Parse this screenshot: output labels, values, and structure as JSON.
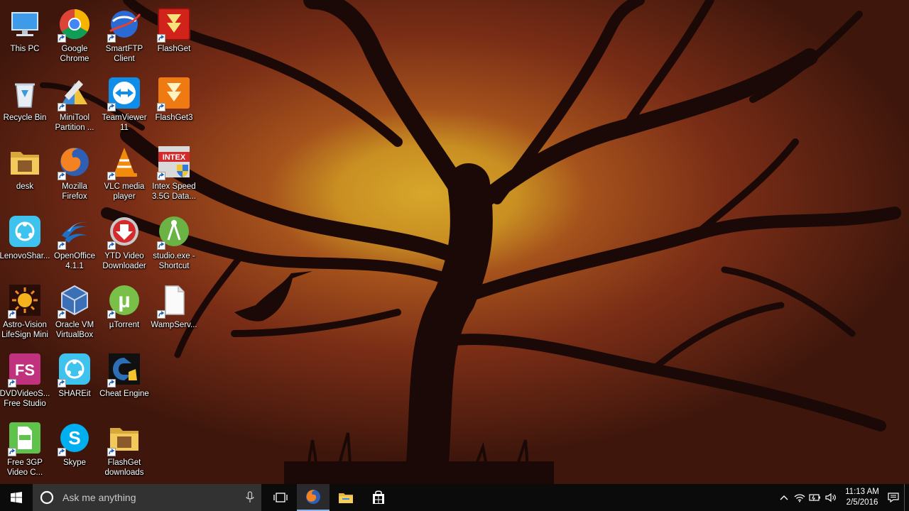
{
  "desktop": {
    "icons": [
      {
        "label": "This PC",
        "icon": "this-pc-icon",
        "shortcut": false
      },
      {
        "label": "Recycle Bin",
        "icon": "recycle-bin-icon",
        "shortcut": false
      },
      {
        "label": "desk",
        "icon": "folder-icon",
        "shortcut": false
      },
      {
        "label": "LenovoShar...",
        "icon": "lenovo-shareit-icon",
        "shortcut": false
      },
      {
        "label": "Astro-Vision LifeSign Mini",
        "icon": "astro-vision-icon",
        "shortcut": true
      },
      {
        "label": "DVDVideoS... Free Studio",
        "icon": "dvdvideosoft-icon",
        "shortcut": true
      },
      {
        "label": "Free 3GP Video C...",
        "icon": "free-3gp-icon",
        "shortcut": true
      },
      {
        "label": "Google Chrome",
        "icon": "chrome-icon",
        "shortcut": true
      },
      {
        "label": "MiniTool Partition ...",
        "icon": "minitool-icon",
        "shortcut": true
      },
      {
        "label": "Mozilla Firefox",
        "icon": "firefox-icon",
        "shortcut": true
      },
      {
        "label": "OpenOffice 4.1.1",
        "icon": "openoffice-icon",
        "shortcut": true
      },
      {
        "label": "Oracle VM VirtualBox",
        "icon": "virtualbox-icon",
        "shortcut": true
      },
      {
        "label": "SHAREit",
        "icon": "shareit-icon",
        "shortcut": true
      },
      {
        "label": "Skype",
        "icon": "skype-icon",
        "shortcut": true
      },
      {
        "label": "SmartFTP Client",
        "icon": "smartftp-icon",
        "shortcut": true
      },
      {
        "label": "TeamViewer 11",
        "icon": "teamviewer-icon",
        "shortcut": true
      },
      {
        "label": "VLC media player",
        "icon": "vlc-icon",
        "shortcut": true
      },
      {
        "label": "YTD Video Downloader",
        "icon": "ytd-icon",
        "shortcut": true
      },
      {
        "label": "µTorrent",
        "icon": "utorrent-icon",
        "shortcut": true
      },
      {
        "label": "Cheat Engine",
        "icon": "cheat-engine-icon",
        "shortcut": true
      },
      {
        "label": "FlashGet downloads",
        "icon": "folder-icon",
        "shortcut": true
      },
      {
        "label": "FlashGet",
        "icon": "flashget-icon",
        "shortcut": true
      },
      {
        "label": "FlashGet3",
        "icon": "flashget3-icon",
        "shortcut": true
      },
      {
        "label": "Intex Speed 3.5G Data...",
        "icon": "intex-icon",
        "shortcut": true
      },
      {
        "label": "studio.exe - Shortcut",
        "icon": "android-studio-icon",
        "shortcut": true
      },
      {
        "label": "WampServ...",
        "icon": "file-icon",
        "shortcut": true
      }
    ]
  },
  "taskbar": {
    "search_placeholder": "Ask me anything",
    "pinned": [
      {
        "name": "task-view",
        "icon": "task-view-icon"
      },
      {
        "name": "firefox",
        "icon": "firefox-icon",
        "active": true
      },
      {
        "name": "file-explorer",
        "icon": "folder-icon"
      },
      {
        "name": "store",
        "icon": "store-icon"
      }
    ],
    "clock": {
      "time": "11:13 AM",
      "date": "2/5/2016"
    },
    "colors": {
      "bar": "#0b0b0c",
      "search": "#323232",
      "accent": "#8ab4e8"
    }
  }
}
